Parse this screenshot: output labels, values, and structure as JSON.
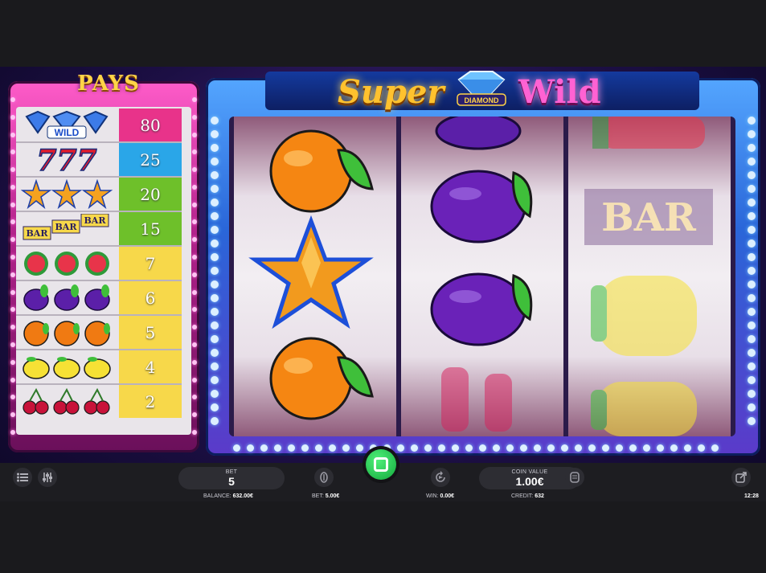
{
  "paytable": {
    "title": "PAYS",
    "rows": [
      {
        "symbol": "wild-diamond",
        "label": "WILD",
        "payout": "80",
        "color": "#e8338a"
      },
      {
        "symbol": "seven",
        "label": "777",
        "payout": "25",
        "color": "#2aa6e8"
      },
      {
        "symbol": "star",
        "label": "",
        "payout": "20",
        "color": "#6ec02a"
      },
      {
        "symbol": "bar",
        "label": "BAR",
        "payout": "15",
        "color": "#6ec02a"
      },
      {
        "symbol": "watermelon",
        "label": "",
        "payout": "7",
        "color": "#f7d84a"
      },
      {
        "symbol": "plum",
        "label": "",
        "payout": "6",
        "color": "#f7d84a"
      },
      {
        "symbol": "orange",
        "label": "",
        "payout": "5",
        "color": "#f7d84a"
      },
      {
        "symbol": "lemon",
        "label": "",
        "payout": "4",
        "color": "#f7d84a"
      },
      {
        "symbol": "cherry",
        "label": "",
        "payout": "2",
        "color": "#f7d84a"
      }
    ]
  },
  "logo": {
    "super": "Super",
    "diamond": "DIAMOND",
    "wild": "Wild"
  },
  "reels": [
    [
      "orange",
      "star",
      "orange"
    ],
    [
      "plum",
      "plum",
      "cherry"
    ],
    [
      "watermelon",
      "bar",
      "lemon"
    ]
  ],
  "reel_bar_text": "BAR",
  "controls": {
    "bet_label": "BET",
    "bet_value": "5",
    "coin_label": "COIN VALUE",
    "coin_value": "1.00€"
  },
  "status": {
    "balance_label": "BALANCE:",
    "balance_value": "632.00€",
    "bet_label": "BET:",
    "bet_value": "5.00€",
    "win_label": "WIN:",
    "win_value": "0.00€",
    "credit_label": "CREDIT:",
    "credit_value": "632",
    "time": "12:28"
  }
}
